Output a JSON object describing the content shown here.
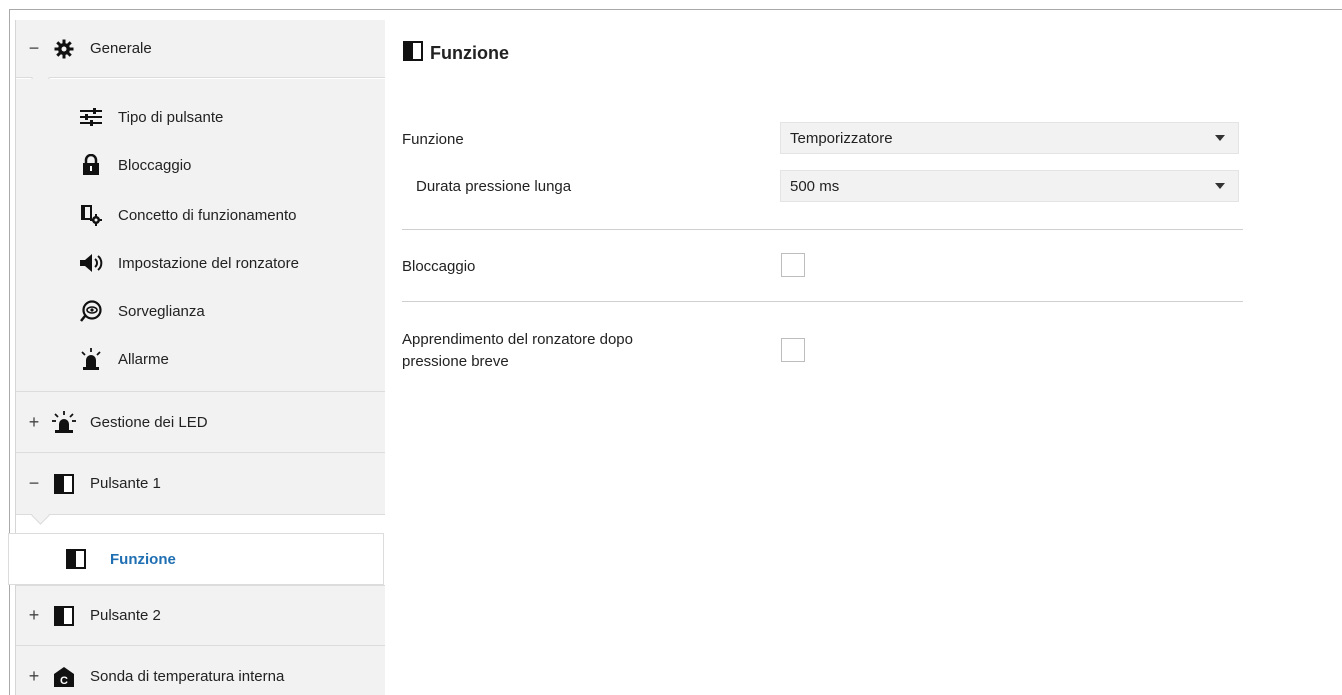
{
  "sidebar": {
    "generale": {
      "toggle": "−",
      "label": "Generale",
      "icon": "gear-icon"
    },
    "generale_items": [
      {
        "label": "Tipo di pulsante",
        "icon": "sliders-icon"
      },
      {
        "label": "Bloccaggio",
        "icon": "lock-icon"
      },
      {
        "label": "Concetto di funzionamento",
        "icon": "device-gear-icon"
      },
      {
        "label": "Impostazione del ronzatore",
        "icon": "speaker-icon"
      },
      {
        "label": "Sorveglianza",
        "icon": "eye-icon"
      },
      {
        "label": "Allarme",
        "icon": "alarm-light-icon"
      }
    ],
    "gestione_led": {
      "toggle": "+",
      "label": "Gestione dei LED",
      "icon": "led-icon"
    },
    "pulsante1": {
      "toggle": "−",
      "label": "Pulsante 1",
      "icon": "button-icon"
    },
    "pulsante1_items": [
      {
        "label": "Funzione",
        "icon": "button-icon",
        "active": true
      }
    ],
    "pulsante2": {
      "toggle": "+",
      "label": "Pulsante 2",
      "icon": "button-icon"
    },
    "sonda": {
      "toggle": "+",
      "label": "Sonda di temperatura interna",
      "icon": "temperature-sensor-icon"
    }
  },
  "main": {
    "title": "Funzione",
    "params": {
      "funzione": {
        "label": "Funzione",
        "value": "Temporizzatore"
      },
      "durata": {
        "label": "Durata pressione lunga",
        "value": "500 ms"
      },
      "bloccaggio": {
        "label": "Bloccaggio",
        "checked": false
      },
      "apprendimento": {
        "label_line1": "Apprendimento del ronzatore dopo",
        "label_line2": "pressione breve",
        "checked": false
      }
    }
  },
  "colors": {
    "active_text": "#1f6fb2",
    "sidebar_bg": "#f2f2f2",
    "field_bg": "#f2f2f2"
  }
}
